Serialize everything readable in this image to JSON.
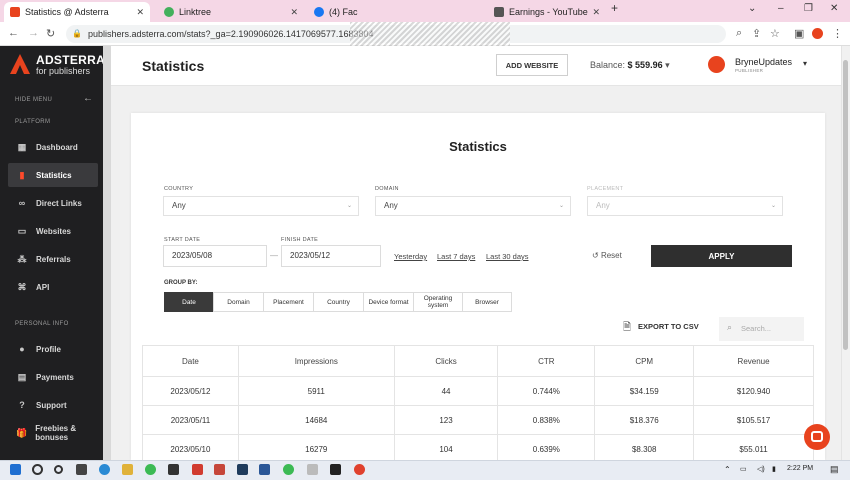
{
  "browser": {
    "tabs": [
      {
        "title": "Statistics @ Adsterra",
        "fav_color": "#e8431e"
      },
      {
        "title": "Linktree",
        "fav_color": "#43b05c"
      },
      {
        "title": "(4) Fac",
        "fav_color": "#1877f2"
      },
      {
        "title": "Earnings - YouTube",
        "fav_color": "#555555"
      }
    ],
    "new_tab": "+",
    "url": "publishers.adsterra.com/stats?_ga=2.190906026.1417069577.1683804"
  },
  "sidebar": {
    "logo": "ADSTERRA",
    "logo_sub": "for publishers",
    "hide_menu": "HIDE MENU",
    "section_platform": "PLATFORM",
    "platform_items": [
      {
        "label": "Dashboard",
        "icon": "▦"
      },
      {
        "label": "Statistics",
        "icon": "▮"
      },
      {
        "label": "Direct Links",
        "icon": "∞"
      },
      {
        "label": "Websites",
        "icon": "▭"
      },
      {
        "label": "Referrals",
        "icon": "⁂"
      },
      {
        "label": "API",
        "icon": "⌘"
      }
    ],
    "section_personal": "PERSONAL INFO",
    "personal_items": [
      {
        "label": "Profile",
        "icon": "●"
      },
      {
        "label": "Payments",
        "icon": "▤"
      },
      {
        "label": "Support",
        "icon": "?"
      },
      {
        "label": "Freebies & bonuses",
        "icon": "🎁"
      }
    ]
  },
  "header": {
    "title": "Statistics",
    "add_website": "ADD WEBSITE",
    "balance_label": "Balance:",
    "balance_value": "$ 559.96",
    "user_name": "BryneUpdates",
    "user_role": "PUBLISHER"
  },
  "filters": {
    "title": "Statistics",
    "country_label": "COUNTRY",
    "country_value": "Any",
    "domain_label": "DOMAIN",
    "domain_value": "Any",
    "placement_label": "PLACEMENT",
    "placement_value": "Any",
    "start_label": "START DATE",
    "start_value": "2023/05/08",
    "finish_label": "FINISH DATE",
    "finish_value": "2023/05/12",
    "range_sep": "—",
    "quick": [
      "Yesterday",
      "Last 7 days",
      "Last 30 days"
    ],
    "reset": "Reset",
    "apply": "APPLY",
    "group_by_label": "GROUP BY:",
    "group_by": [
      "Date",
      "Domain",
      "Placement",
      "Country",
      "Device format",
      "Operating system",
      "Browser"
    ],
    "group_by_active": "Date",
    "export": "EXPORT TO CSV",
    "search_placeholder": "Search..."
  },
  "table": {
    "columns": [
      "Date",
      "Impressions",
      "Clicks",
      "CTR",
      "CPM",
      "Revenue"
    ],
    "rows": [
      [
        "2023/05/12",
        "5911",
        "44",
        "0.744%",
        "$34.159",
        "$120.940"
      ],
      [
        "2023/05/11",
        "14684",
        "123",
        "0.838%",
        "$18.376",
        "$105.517"
      ],
      [
        "2023/05/10",
        "16279",
        "104",
        "0.639%",
        "$8.308",
        "$55.011"
      ]
    ]
  },
  "taskbar": {
    "time": "2:22 PM"
  },
  "colors": {
    "accent": "#e8431e",
    "sidebar_bg": "#1f1f21",
    "apply_bg": "#2f2f2f"
  }
}
